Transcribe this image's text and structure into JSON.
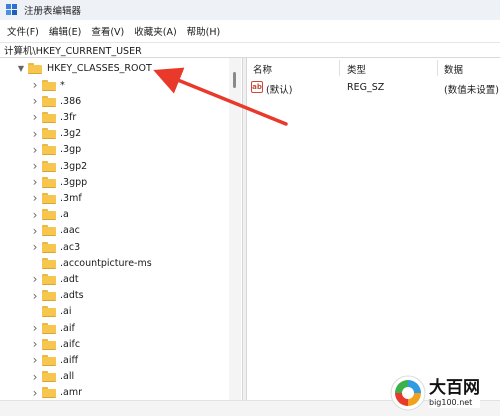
{
  "window": {
    "title": "注册表编辑器"
  },
  "menu": [
    "文件(F)",
    "编辑(E)",
    "查看(V)",
    "收藏夹(A)",
    "帮助(H)"
  ],
  "address": "计算机\\HKEY_CURRENT_USER",
  "tree": {
    "root": "HKEY_CLASSES_ROOT",
    "children": [
      "*",
      ".386",
      ".3fr",
      ".3g2",
      ".3gp",
      ".3gp2",
      ".3gpp",
      ".3mf",
      ".a",
      ".aac",
      ".ac3",
      ".accountpicture-ms",
      ".adt",
      ".adts",
      ".ai",
      ".aif",
      ".aifc",
      ".aiff",
      ".all",
      ".amr"
    ],
    "expanded_no_chevron": [
      ".accountpicture-ms",
      ".ai"
    ]
  },
  "values": {
    "headers": {
      "name": "名称",
      "type": "类型",
      "data": "数据"
    },
    "rows": [
      {
        "icon": "string-value-icon",
        "name": "(默认)",
        "type": "REG_SZ",
        "data": "(数值未设置)"
      }
    ]
  },
  "annotation": {
    "color": "#e8392b"
  },
  "watermark": {
    "title": "大百网",
    "url": "big100.net"
  },
  "colors": {
    "folder": "#f6c64e",
    "titlebar": "#eef1f6"
  }
}
